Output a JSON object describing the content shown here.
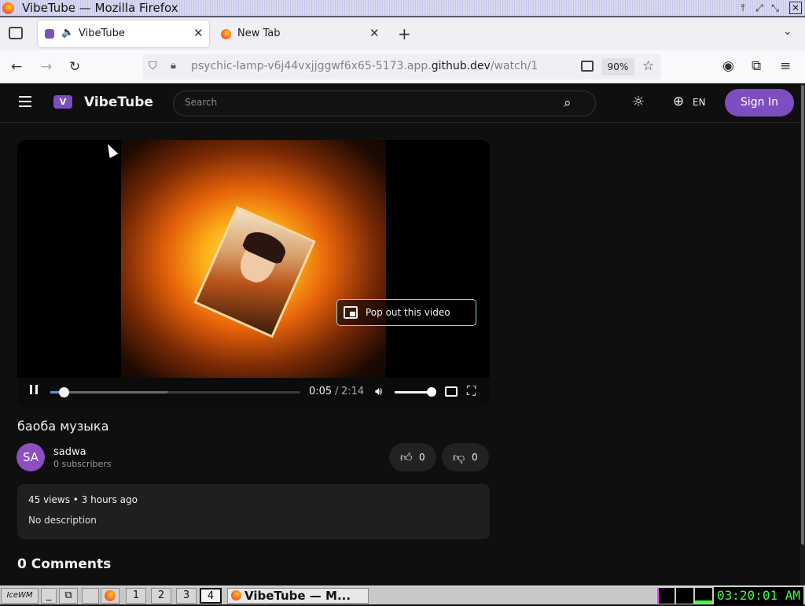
{
  "window": {
    "title": "VibeTube — Mozilla Firefox"
  },
  "browser": {
    "tabs": [
      {
        "label": "VibeTube",
        "active": true
      },
      {
        "label": "New Tab",
        "active": false
      }
    ],
    "url_dim_prefix": "psychic-lamp-v6j44vxjjggwf6x65-5173.app.",
    "url_host": "github.dev",
    "url_path": "/watch/1",
    "zoom": "90%"
  },
  "app": {
    "brand": "VibeTube",
    "brand_badge": "V",
    "search_placeholder": "Search",
    "language": "EN",
    "signin_label": "Sign In",
    "accent": "#7d4ec0"
  },
  "player": {
    "popout_label": "Pop out this video",
    "current_time": "0:05",
    "separator": "/",
    "duration": "2:14",
    "progress_fraction": 0.04,
    "buffered_fraction": 0.47,
    "volume_fraction": 1.0
  },
  "video": {
    "title": "баоба музыка",
    "channel": {
      "initials": "SA",
      "name": "sadwa",
      "subscribers": "0 subscribers"
    },
    "likes": "0",
    "dislikes": "0",
    "stats": "45 views • 3 hours ago",
    "description": "No description",
    "comments_heading": "0 Comments"
  },
  "taskbar": {
    "launcher": "IceWM",
    "workspaces": [
      "1",
      "2",
      "3",
      "4"
    ],
    "active_workspace": "4",
    "window_button": "VibeTube — M...",
    "clock": "03:20:01 AM"
  }
}
